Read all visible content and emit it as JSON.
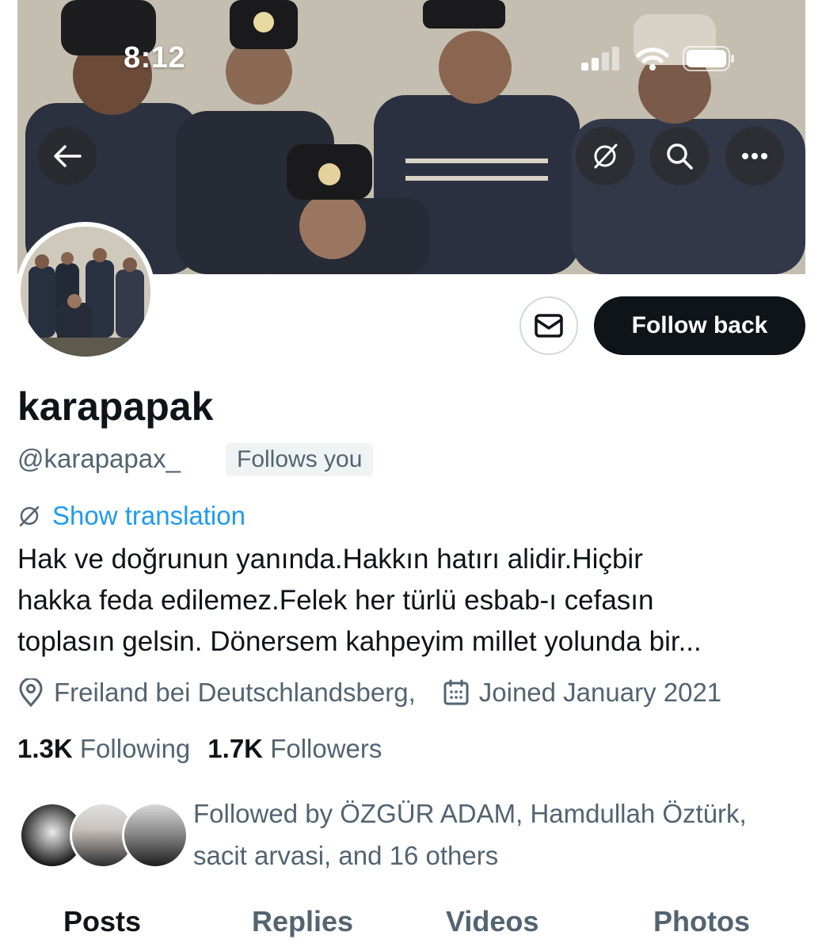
{
  "status_bar": {
    "time": "8:12"
  },
  "banner": {
    "icons": [
      "back-arrow-icon",
      "translate-icon",
      "search-icon",
      "more-icon"
    ]
  },
  "actions": {
    "follow_label": "Follow back",
    "message_icon": "envelope-icon"
  },
  "profile": {
    "display_name": "karapapak",
    "handle": "@karapapax_",
    "follows_you_badge": "Follows you",
    "translate_label": "Show translation",
    "bio_lines": [
      "Hak ve doğrunun yanında.Hakkın hatırı alidir.Hiçbir",
      "hakka feda edilemez.Felek her türlü esbab-ı cefasın",
      "toplasın gelsin. Dönersem kahpeyim millet yolunda bir..."
    ],
    "location": "Freiland bei Deutschlandsberg,",
    "joined": "Joined January 2021"
  },
  "stats": {
    "following_count": "1.3K",
    "following_label": "Following",
    "followers_count": "1.7K",
    "followers_label": "Followers"
  },
  "followed_by": {
    "line1": "Followed by ÖZGÜR ADAM, Hamdullah Öztürk,",
    "line2": "sacit arvasi, and 16 others"
  },
  "tabs": [
    "Posts",
    "Replies",
    "Videos",
    "Photos"
  ],
  "colors": {
    "accent": "#1d9bf0",
    "text": "#0f1419",
    "muted": "#536471",
    "button_bg": "#0f1419"
  }
}
